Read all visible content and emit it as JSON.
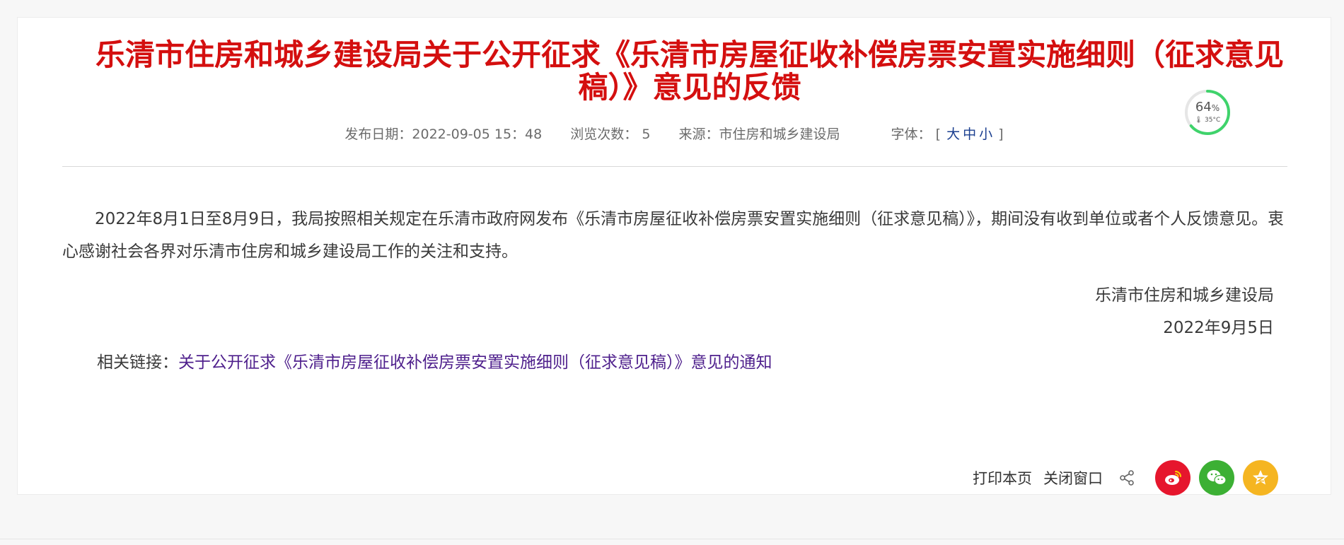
{
  "article": {
    "title": "乐清市住房和城乡建设局关于公开征求《乐清市房屋征收补偿房票安置实施细则（征求意见稿）》意见的反馈",
    "meta": {
      "date_label": "发布日期：",
      "date_value": "2022-09-05 15：48",
      "views_label": "浏览次数：",
      "views_value": "5",
      "source_label": "来源：",
      "source_value": "市住房和城乡建设局",
      "font_label": "字体：",
      "font_open": "[",
      "font_large": "大",
      "font_medium": "中",
      "font_small": "小",
      "font_close": "]"
    },
    "body": "2022年8月1日至8月9日，我局按照相关规定在乐清市政府网发布《乐清市房屋征收补偿房票安置实施细则（征求意见稿）》，期间没有收到单位或者个人反馈意见。衷心感谢社会各界对乐清市住房和城乡建设局工作的关注和支持。",
    "signature_org": "乐清市住房和城乡建设局",
    "signature_date": "2022年9月5日",
    "related_label": "相关链接：",
    "related_link": "关于公开征求《乐清市房屋征收补偿房票安置实施细则（征求意见稿）》意见的通知"
  },
  "gauge": {
    "percent": "64",
    "percent_unit": "%",
    "temperature": "35°C"
  },
  "actions": {
    "print": "打印本页",
    "close": "关闭窗口"
  },
  "icons": {
    "share": "share-icon",
    "weibo": "weibo-icon",
    "wechat": "wechat-icon",
    "qzone": "qzone-icon"
  },
  "colors": {
    "title": "#d40f0f",
    "link": "#4e1f8c",
    "font_link": "#1a3e8f",
    "weibo": "#e6162d",
    "wechat": "#3cb034",
    "qzone": "#f5b521",
    "gauge_ring": "#3fd36b"
  }
}
